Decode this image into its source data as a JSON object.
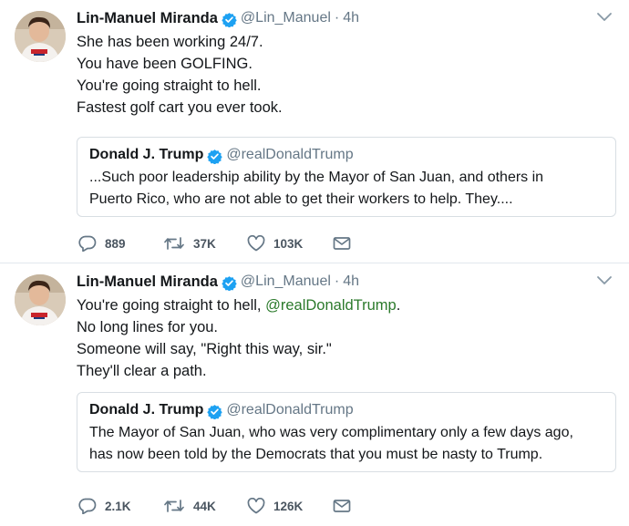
{
  "tweets": [
    {
      "author": {
        "name": "Lin-Manuel Miranda",
        "handle": "@Lin_Manuel",
        "time": "4h"
      },
      "lines": [
        {
          "text": "She has been working 24/7."
        },
        {
          "text": "You have been GOLFING."
        },
        {
          "text": "You're going straight to hell."
        },
        {
          "text": "Fastest golf cart you ever took."
        }
      ],
      "quote": {
        "name": "Donald J. Trump",
        "handle": "@realDonaldTrump",
        "lines": [
          "...Such poor leadership ability by the Mayor of San Juan, and others in",
          "Puerto Rico, who are not able to get their workers to help. They...."
        ]
      },
      "actions": {
        "replies": "889",
        "retweets": "37K",
        "likes": "103K"
      }
    },
    {
      "author": {
        "name": "Lin-Manuel Miranda",
        "handle": "@Lin_Manuel",
        "time": "4h"
      },
      "lines": [
        {
          "text": "You're going straight to hell, ",
          "mention": "@realDonaldTrump",
          "after": "."
        },
        {
          "text": "No long lines for you."
        },
        {
          "text": "Someone will say, \"Right this way, sir.\""
        },
        {
          "text": "They'll clear a path."
        }
      ],
      "quote": {
        "name": "Donald J. Trump",
        "handle": "@realDonaldTrump",
        "lines": [
          "The Mayor of San Juan, who was very complimentary only a few days ago,",
          "has now been told by the Democrats that you must be nasty to Trump."
        ]
      },
      "actions": {
        "replies": "2.1K",
        "retweets": "44K",
        "likes": "126K"
      }
    }
  ],
  "meta": {
    "separator_symbol": "·"
  },
  "colors": {
    "verified": "#1da1f2",
    "mention": "#2b7a2b",
    "secondary_text": "#657786",
    "icon": "#657786"
  },
  "icons": [
    "avatar",
    "verified-badge-icon",
    "chevron-down-icon",
    "reply-icon",
    "retweet-icon",
    "like-icon",
    "direct-message-icon"
  ]
}
